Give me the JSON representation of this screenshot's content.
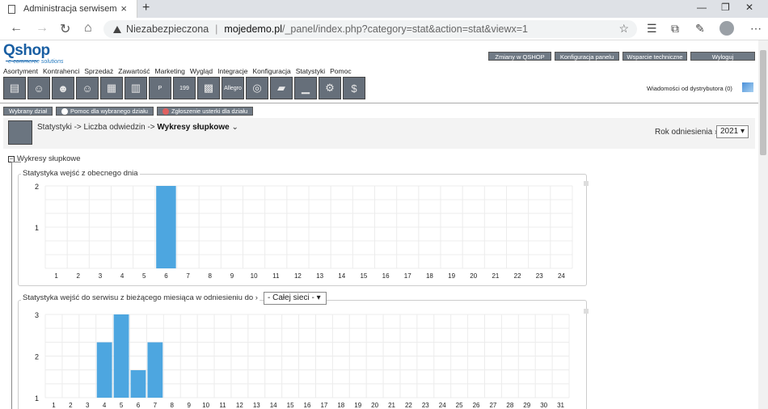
{
  "browser": {
    "tab_title": "Administracja serwisem",
    "new_tab_symbol": "+",
    "close_symbol": "×",
    "insecure_label": "Niezabezpieczona",
    "url_host": "mojedemo.pl",
    "url_path": "/_panel/index.php?category=stat&action=stat&viewx=1"
  },
  "header": {
    "logo_text": "Qshop",
    "logo_sub": "e-commerce solutions",
    "top_buttons": [
      "Zmiany w QSHOP",
      "Konfiguracja panelu",
      "Wsparcie techniczne",
      "Wyloguj"
    ],
    "menu": [
      "Asortyment",
      "Kontrahenci",
      "Sprzedaż",
      "Zawartość",
      "Marketing",
      "Wygląd",
      "Integracje",
      "Konfiguracja",
      "Statystyki",
      "Pomoc"
    ],
    "distributor_msgs": "Wiadomości od dystrybutora (0)",
    "icon_labels": [
      "",
      "",
      "",
      "",
      "",
      "",
      "P",
      "199",
      "",
      "Allegro",
      "",
      "",
      "",
      "",
      "$"
    ]
  },
  "subtabs": [
    "Wybrany dział",
    "Pomoc dla wybranego działu",
    "Zgłoszenie usterki dla działu"
  ],
  "breadcrumb": {
    "part1": "Statystyki -> Liczba odwiedzin ->",
    "current": "Wykresy słupkowe",
    "year_label": "Rok odniesienia",
    "year_value": "2021"
  },
  "section_title": "Wykresy słupkowe",
  "chart1_title": "Statystyka wejść z obecnego dnia",
  "chart2_title": "Statystyka wejść do serwisu z bieżącego miesiąca w odniesieniu do",
  "chart2_scope": "- Całej sieci -",
  "chart_data": [
    {
      "type": "bar",
      "title": "Statystyka wejść z obecnego dnia",
      "categories": [
        "1",
        "2",
        "3",
        "4",
        "5",
        "6",
        "7",
        "8",
        "9",
        "10",
        "11",
        "12",
        "13",
        "14",
        "15",
        "16",
        "17",
        "18",
        "19",
        "20",
        "21",
        "22",
        "23",
        "24"
      ],
      "values": [
        0,
        0,
        0,
        0,
        0,
        2,
        0,
        0,
        0,
        0,
        0,
        0,
        0,
        0,
        0,
        0,
        0,
        0,
        0,
        0,
        0,
        0,
        0,
        0
      ],
      "ylim": [
        0,
        2
      ],
      "yticks": [
        "2",
        "1"
      ],
      "color": "#4da6e0",
      "grid": true
    },
    {
      "type": "bar",
      "title": "Statystyka wejść do serwisu z bieżącego miesiąca w odniesieniu do",
      "categories": [
        "1",
        "2",
        "3",
        "4",
        "5",
        "6",
        "7",
        "8",
        "9",
        "10",
        "11",
        "12",
        "13",
        "14",
        "15",
        "16",
        "17",
        "18",
        "19",
        "20",
        "21",
        "22",
        "23",
        "24",
        "25",
        "26",
        "27",
        "28",
        "29",
        "30",
        "31"
      ],
      "values": [
        0,
        0,
        0,
        2.33,
        3,
        1.66,
        2.33,
        0,
        0,
        0,
        0,
        0,
        0,
        0,
        0,
        0,
        0,
        0,
        0,
        0,
        0,
        0,
        0,
        0,
        0,
        0,
        0,
        0,
        0,
        0,
        0
      ],
      "ylim": [
        1,
        3
      ],
      "yticks": [
        "3",
        "2",
        "1"
      ],
      "color": "#4da6e0",
      "grid": true
    }
  ]
}
